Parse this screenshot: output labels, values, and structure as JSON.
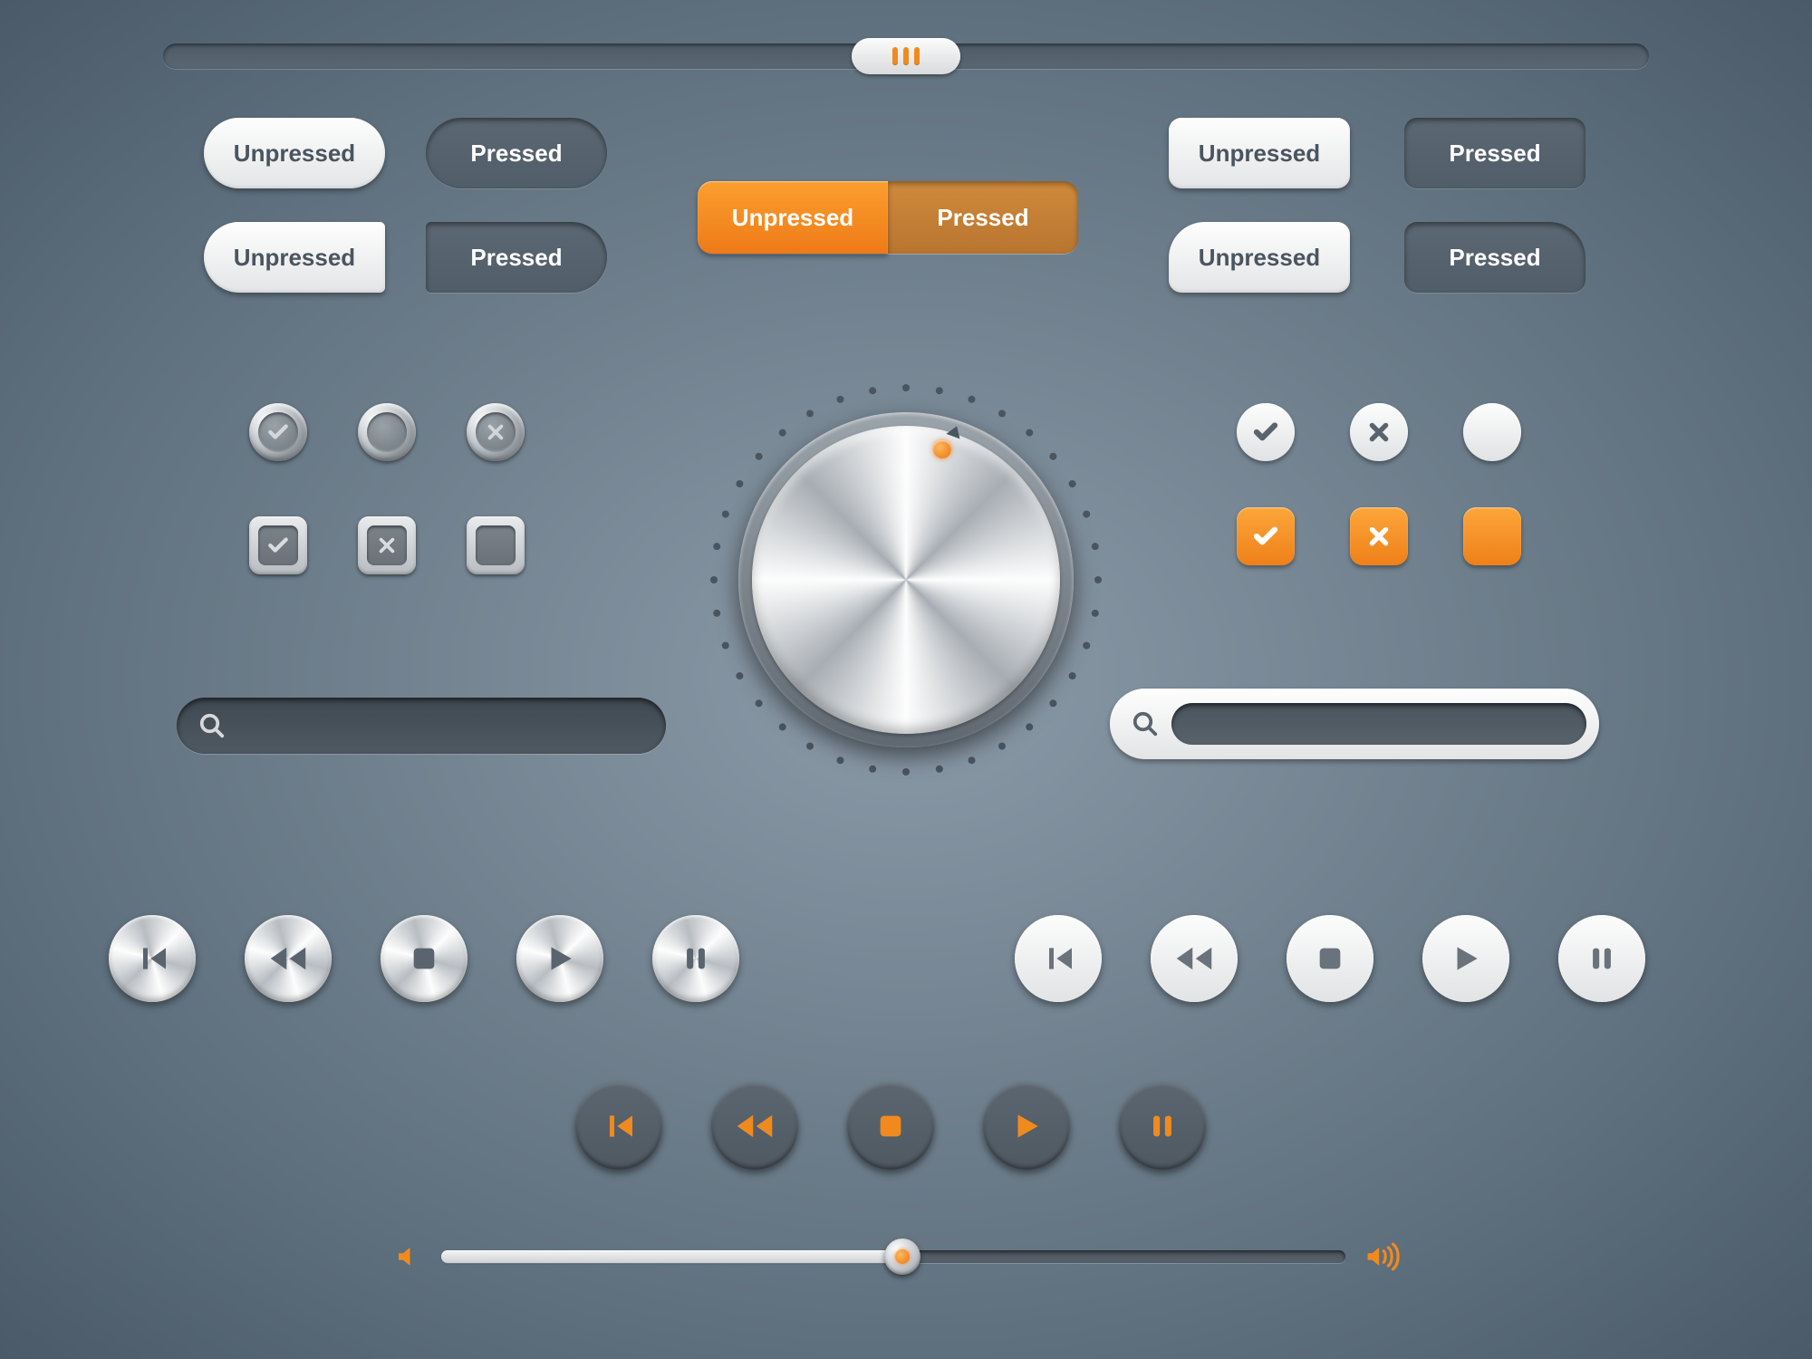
{
  "colors": {
    "accent": "#f08a1f",
    "lightText": "#4a5560",
    "darkText": "#ffffff"
  },
  "topSlider": {
    "position_pct": 50
  },
  "buttons": {
    "left_pill_unpressed": "Unpressed",
    "left_pill_pressed": "Pressed",
    "left_half_unpressed": "Unpressed",
    "left_half_pressed": "Pressed",
    "right_rect_unpressed": "Unpressed",
    "right_rect_pressed": "Pressed",
    "right_cut_unpressed": "Unpressed",
    "right_cut_pressed": "Pressed",
    "toggle_unpressed": "Unpressed",
    "toggle_pressed": "Pressed"
  },
  "checkboxes_metal": {
    "circle": [
      "check",
      "blank",
      "cross"
    ],
    "square": [
      "check",
      "cross",
      "blank"
    ]
  },
  "checkboxes_flat": {
    "circle": [
      "check",
      "cross",
      "blank"
    ],
    "square": [
      "check",
      "cross",
      "blank"
    ]
  },
  "knob": {
    "angle_deg": 20
  },
  "search": {
    "dark_placeholder": "",
    "light_placeholder": ""
  },
  "media": {
    "order": [
      "skip-back",
      "rewind",
      "stop",
      "play",
      "pause"
    ]
  },
  "volume": {
    "level_pct": 51
  }
}
